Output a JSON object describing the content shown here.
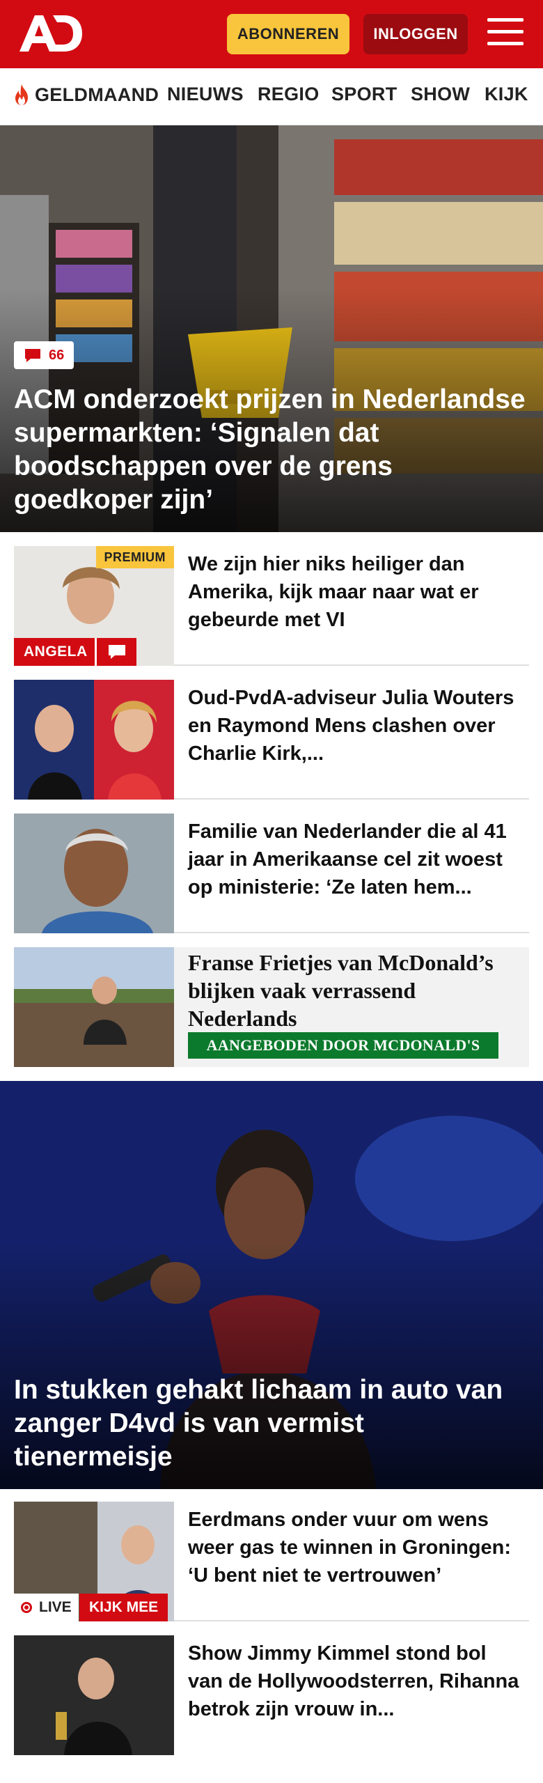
{
  "header": {
    "logo": "AD",
    "subscribe_label": "ABONNEREN",
    "login_label": "INLOGGEN",
    "brand_color": "#d20b12"
  },
  "nav": {
    "items": [
      {
        "label": "GELDMAAND",
        "icon": "flame-icon"
      },
      {
        "label": "NIEUWS"
      },
      {
        "label": "REGIO"
      },
      {
        "label": "SPORT"
      },
      {
        "label": "SHOW"
      },
      {
        "label": "KIJK"
      }
    ]
  },
  "hero1": {
    "comments": "66",
    "title": "ACM onderzoekt prijzen in Nederland­se supermarkten: ‘Signalen dat boodschappen over de grens goedkoper zijn’"
  },
  "articles1": [
    {
      "title": "We zijn hier niks heiliger dan Amerika, kijk maar naar wat er gebeurde met VI",
      "premium": "PREMIUM",
      "tag": "ANGELA"
    },
    {
      "title": "Oud-PvdA-adviseur Julia Wouters en Raymond Mens clashen over Charlie Kirk,..."
    },
    {
      "title": "Familie van Nederlander die al 41 jaar in Amerikaanse cel zit woest op ministerie: ‘Ze laten hem..."
    },
    {
      "title": "Franse Frietjes van McDonald’s blijken vaak verrassend Nederlands",
      "sponsor": "AANGEBODEN DOOR MCDONALD'S"
    }
  ],
  "hero2": {
    "title": "In stukken gehakt lichaam in auto van zanger D4vd is van vermist tienermeisje"
  },
  "articles2": [
    {
      "title": "Eerdmans onder vuur om wens weer gas te winnen in Groningen: ‘U bent niet te vertrouwen’",
      "live": "LIVE",
      "watch": "KIJK MEE"
    },
    {
      "title": "Show Jimmy Kimmel stond bol van de Hollywoodsterren, Rihanna betrok zijn vrouw in..."
    }
  ]
}
